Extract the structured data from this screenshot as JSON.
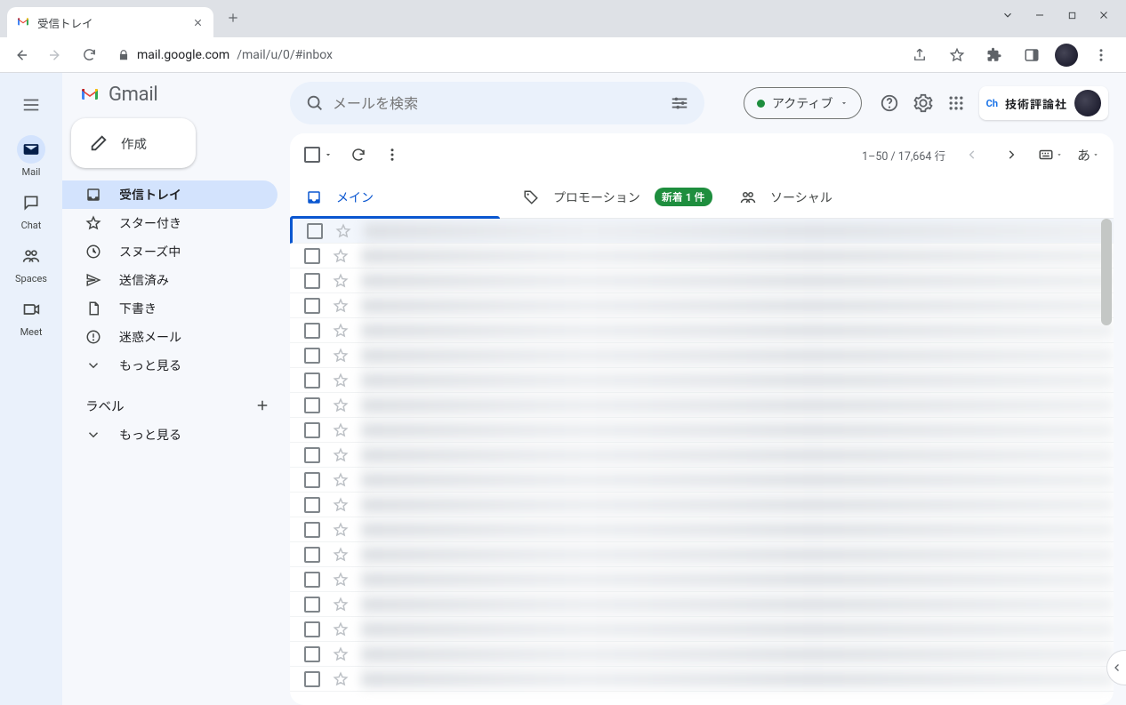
{
  "browser": {
    "tab_title": "受信トレイ",
    "url_host": "mail.google.com",
    "url_path": "/mail/u/0/#inbox"
  },
  "rail": {
    "items": [
      {
        "label": "Mail",
        "icon": "mail"
      },
      {
        "label": "Chat",
        "icon": "chat"
      },
      {
        "label": "Spaces",
        "icon": "spaces"
      },
      {
        "label": "Meet",
        "icon": "meet"
      }
    ]
  },
  "logo_text": "Gmail",
  "compose_label": "作成",
  "nav": [
    {
      "label": "受信トレイ",
      "icon": "inbox",
      "active": true
    },
    {
      "label": "スター付き",
      "icon": "star"
    },
    {
      "label": "スヌーズ中",
      "icon": "clock"
    },
    {
      "label": "送信済み",
      "icon": "send"
    },
    {
      "label": "下書き",
      "icon": "draft"
    },
    {
      "label": "迷惑メール",
      "icon": "spam"
    },
    {
      "label": "もっと見る",
      "icon": "expand"
    }
  ],
  "labels_header": "ラベル",
  "labels_more": "もっと見る",
  "search_placeholder": "メールを検索",
  "status_text": "アクティブ",
  "org_text": "技術評論社",
  "pagination": "1–50 / 17,664 行",
  "lang_glyph": "あ",
  "tabs": [
    {
      "label": "メイン",
      "icon": "inbox",
      "active": true
    },
    {
      "label": "プロモーション",
      "icon": "tag",
      "badge": "新着 1 件"
    },
    {
      "label": "ソーシャル",
      "icon": "social"
    }
  ],
  "row_count": 19
}
